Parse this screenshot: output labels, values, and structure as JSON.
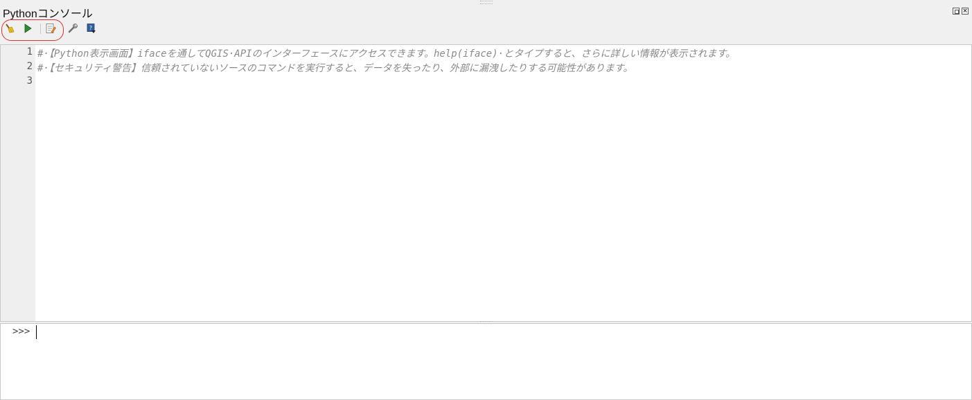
{
  "window": {
    "title": "Pythonコンソール"
  },
  "toolbar": {
    "items": [
      {
        "name": "clear-console",
        "icon": "broom-icon"
      },
      {
        "name": "run-command",
        "icon": "play-icon"
      },
      {
        "name": "show-editor",
        "icon": "editor-icon"
      },
      {
        "name": "options",
        "icon": "wrench-icon"
      },
      {
        "name": "help",
        "icon": "help-book-icon"
      }
    ]
  },
  "editor": {
    "line_numbers": [
      "1",
      "2",
      "3"
    ],
    "lines": [
      "#·【Python表示画面】ifaceを通してQGIS·APIのインターフェースにアクセスできます。help(iface)·とタイプすると、さらに詳しい情報が表示されます。",
      "#·【セキュリティ警告】信頼されていないソースのコマンドを実行すると、データを失ったり、外部に漏洩したりする可能性があります。",
      ""
    ]
  },
  "input": {
    "prompt": ">>>",
    "value": ""
  },
  "colors": {
    "comment": "#8a8a8a",
    "highlight_ring": "#e0302a",
    "run_green": "#2e8b2e"
  }
}
